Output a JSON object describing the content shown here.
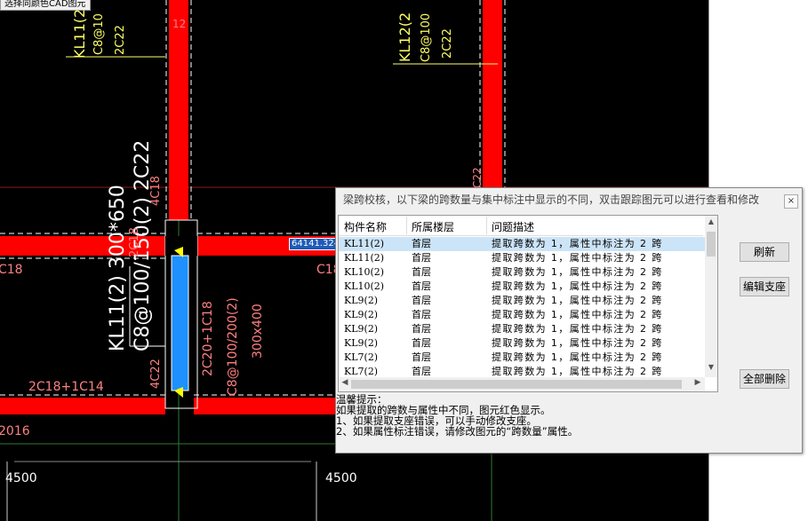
{
  "cad": {
    "top_button": "选择同颜色CAD图元",
    "labels": {
      "kl11_a": "KL11(2",
      "kl11_a_stirrup": "C8@10",
      "kl11_a_bars": "2C22",
      "kl12": "KL12(2",
      "kl12_stirrup": "C8@100",
      "kl12_bars": "2C22",
      "col_num": "12",
      "main_name": "KL11(2)  300*650",
      "main_stirrup": "C8@100/150(2)  2C22",
      "left_bars_upper": "4C18",
      "left_bars_mid": "2C18",
      "left_bars_lower": "4C22",
      "left_span_bars": "2C18+1C14",
      "left_bottom_bars": "2016",
      "right_bars": "2C20+1C18",
      "right_stirrup": "C8@100/200(2)",
      "right_size": "300x400",
      "c18": "C18",
      "coord_box": "64141.324",
      "dim_left": "4500",
      "dim_right": "4500",
      "c22_partial": "C22"
    }
  },
  "dialog": {
    "title": "梁跨校核，以下梁的跨数量与集中标注中显示的不同，双击跟踪图元可以进行查看和修改",
    "close_label": "×",
    "columns": [
      "构件名称",
      "所属楼层",
      "问题描述"
    ],
    "rows": [
      {
        "name": "KL11(2)",
        "floor": "首层",
        "issue": "提取跨数为 1，属性中标注为 2 跨",
        "selected": true
      },
      {
        "name": "KL11(2)",
        "floor": "首层",
        "issue": "提取跨数为 1，属性中标注为 2 跨",
        "selected": false
      },
      {
        "name": "KL10(2)",
        "floor": "首层",
        "issue": "提取跨数为 1，属性中标注为 2 跨",
        "selected": false
      },
      {
        "name": "KL10(2)",
        "floor": "首层",
        "issue": "提取跨数为 1，属性中标注为 2 跨",
        "selected": false
      },
      {
        "name": "KL9(2)",
        "floor": "首层",
        "issue": "提取跨数为 1，属性中标注为 2 跨",
        "selected": false
      },
      {
        "name": "KL9(2)",
        "floor": "首层",
        "issue": "提取跨数为 1，属性中标注为 2 跨",
        "selected": false
      },
      {
        "name": "KL9(2)",
        "floor": "首层",
        "issue": "提取跨数为 1，属性中标注为 2 跨",
        "selected": false
      },
      {
        "name": "KL9(2)",
        "floor": "首层",
        "issue": "提取跨数为 1，属性中标注为 2 跨",
        "selected": false
      },
      {
        "name": "KL7(2)",
        "floor": "首层",
        "issue": "提取跨数为 1，属性中标注为 2 跨",
        "selected": false
      },
      {
        "name": "KL7(2)",
        "floor": "首层",
        "issue": "提取跨数为 1，属性中标注为 2 跨",
        "selected": false
      }
    ],
    "buttons": {
      "refresh": "刷新",
      "edit_support": "编辑支座",
      "delete_all": "全部删除"
    },
    "tip": {
      "heading": "温馨提示：",
      "line0": "如果提取的跨数与属性中不同，图元红色显示。",
      "line1": "1、如果提取支座错误，可以手动修改支座。",
      "line2": "2、如果属性标注错误，请修改图元的“跨数量”属性。"
    }
  },
  "colors": {
    "cad_background": "#000000",
    "beam_red": "#ff0000",
    "selected_beam": "#1e90ff",
    "label_yellow": "#ffff66",
    "label_pink": "#ff8080",
    "label_white": "#ffffff",
    "list_selection": "#cce4f7"
  }
}
